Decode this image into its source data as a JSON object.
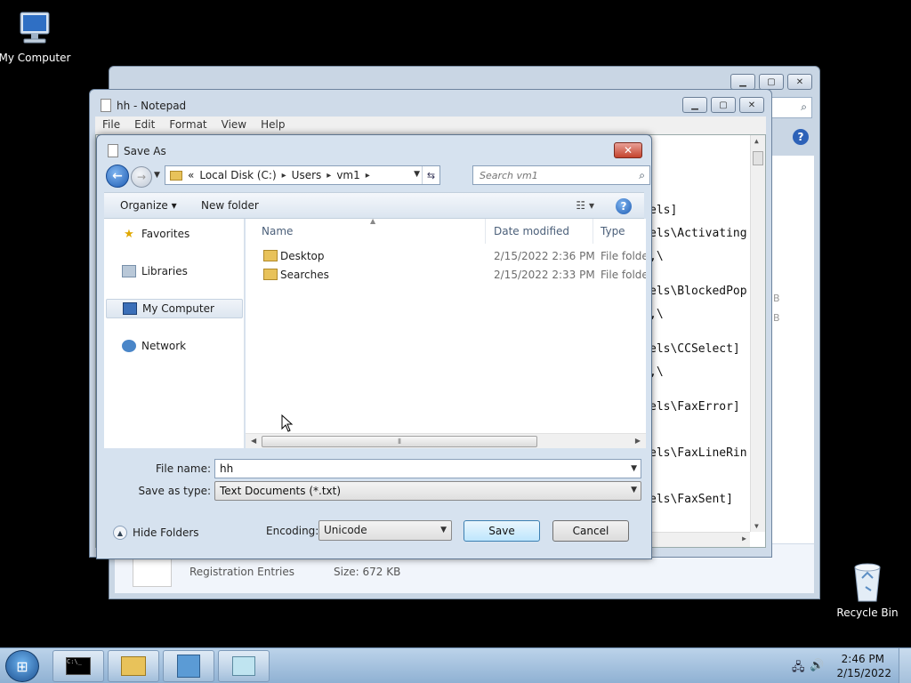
{
  "desktop": {
    "my_computer_label": "My Computer",
    "recycle_bin_label": "Recycle Bin"
  },
  "explorer_bg": {
    "details_type": "Registration Entries",
    "details_size": "Size: 672 KB",
    "side_chars": [
      "B",
      "B"
    ]
  },
  "notepad": {
    "title": "hh - Notepad",
    "menu": [
      "File",
      "Edit",
      "Format",
      "View",
      "Help"
    ],
    "lines": [
      "els]",
      "els\\Activating",
      ",\\",
      "els\\BlockedPop",
      ",\\",
      "els\\CCSelect]",
      ",\\",
      "els\\FaxError]",
      "els\\FaxLineRin",
      "els\\FaxSent]"
    ]
  },
  "dialog": {
    "title": "Save As",
    "breadcrumb": {
      "overflow": "«",
      "items": [
        "Local Disk (C:)",
        "Users",
        "vm1"
      ]
    },
    "search_placeholder": "Search vm1",
    "toolbar": {
      "organize": "Organize ▾",
      "new_folder": "New folder"
    },
    "nav": [
      {
        "label": "Favorites",
        "icon": "star-icon"
      },
      {
        "label": "Libraries",
        "icon": "libraries-icon"
      },
      {
        "label": "My Computer",
        "icon": "computer-icon",
        "selected": true
      },
      {
        "label": "Network",
        "icon": "network-icon"
      }
    ],
    "columns": [
      "Name",
      "Date modified",
      "Type"
    ],
    "files": [
      {
        "name": "Desktop",
        "date": "2/15/2022 2:36 PM",
        "type": "File folder"
      },
      {
        "name": "Searches",
        "date": "2/15/2022 2:33 PM",
        "type": "File folder"
      }
    ],
    "file_name_label": "File name:",
    "file_name_value": "hh",
    "save_type_label": "Save as type:",
    "save_type_value": "Text Documents (*.txt)",
    "hide_folders": "Hide Folders",
    "encoding_label": "Encoding:",
    "encoding_value": "Unicode",
    "save_button": "Save",
    "cancel_button": "Cancel"
  },
  "taskbar": {
    "time": "2:46 PM",
    "date": "2/15/2022",
    "cmd_text": "C:\\_"
  }
}
